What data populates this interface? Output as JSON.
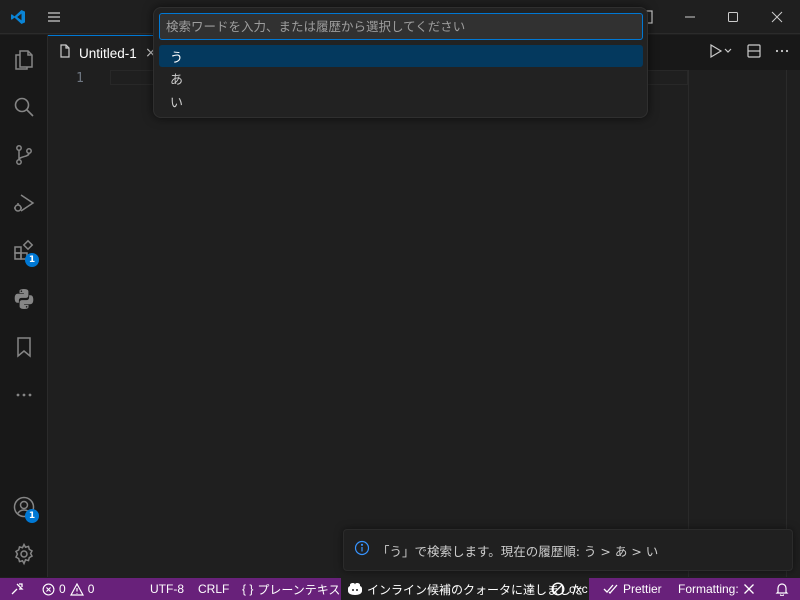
{
  "colors": {
    "accent": "#0078d4",
    "status_bar": "#68217a",
    "selected_item": "#04395e",
    "background": "#1f1f1f"
  },
  "titlebar": {
    "icons": [
      "vscode-logo-icon",
      "menu-icon",
      "layout-icon",
      "minimize-icon",
      "maximize-icon",
      "close-icon"
    ]
  },
  "activity_bar": {
    "items": [
      {
        "name": "explorer",
        "icon": "files-icon"
      },
      {
        "name": "search",
        "icon": "search-icon"
      },
      {
        "name": "source-control",
        "icon": "source-control-icon"
      },
      {
        "name": "run-debug",
        "icon": "run-debug-icon"
      },
      {
        "name": "extensions",
        "icon": "extensions-icon",
        "badge": "1"
      },
      {
        "name": "python",
        "icon": "python-icon"
      },
      {
        "name": "bookmarks",
        "icon": "bookmark-icon"
      },
      {
        "name": "more",
        "icon": "ellipsis-icon"
      }
    ],
    "bottom": [
      {
        "name": "accounts",
        "icon": "account-icon",
        "badge": "1"
      },
      {
        "name": "manage",
        "icon": "gear-icon"
      }
    ]
  },
  "tabs": [
    {
      "label": "Untitled-1",
      "icon": "file-icon",
      "active": true
    }
  ],
  "editor": {
    "line_numbers": [
      "1"
    ]
  },
  "quick_pick": {
    "placeholder": "検索ワードを入力、または履歴から選択してください",
    "value": "",
    "items": [
      {
        "label": "う",
        "selected": true
      },
      {
        "label": "あ",
        "selected": false
      },
      {
        "label": "い",
        "selected": false
      }
    ]
  },
  "notification": {
    "icon": "info-icon",
    "text": "「う」で検索します。現在の履歴順: う > あ > い"
  },
  "status_bar": {
    "errors": "0",
    "warnings": "0",
    "encoding": "UTF-8",
    "eol": "CRLF",
    "language": "プレーンテキスト",
    "language_icon": "{ }",
    "copilot": "インライン候補のクォータに達しました",
    "oxc": "oxc",
    "prettier": "Prettier",
    "formatting": "Formatting:"
  }
}
